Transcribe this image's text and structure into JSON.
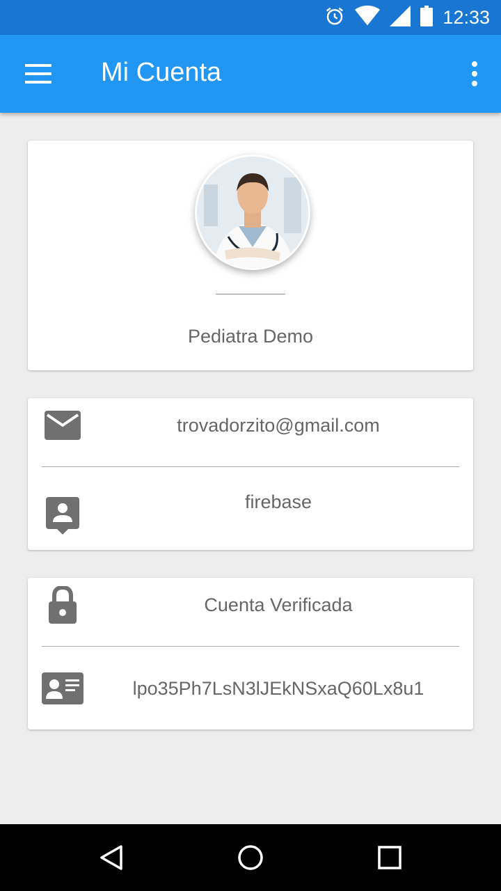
{
  "status_bar": {
    "time": "12:33"
  },
  "app_bar": {
    "title": "Mi Cuenta"
  },
  "profile": {
    "name": "Pediatra  Demo"
  },
  "contact": {
    "email": "trovadorzito@gmail.com",
    "provider": "firebase"
  },
  "account": {
    "status": "Cuenta Verificada",
    "uid": "lpo35Ph7LsN3lJEkNSxaQ60Lx8u1"
  },
  "colors": {
    "status_bar": "#1976d2",
    "app_bar": "#2196f3",
    "icon_gray": "#707070",
    "text_gray": "#666666",
    "background": "#ededed"
  }
}
